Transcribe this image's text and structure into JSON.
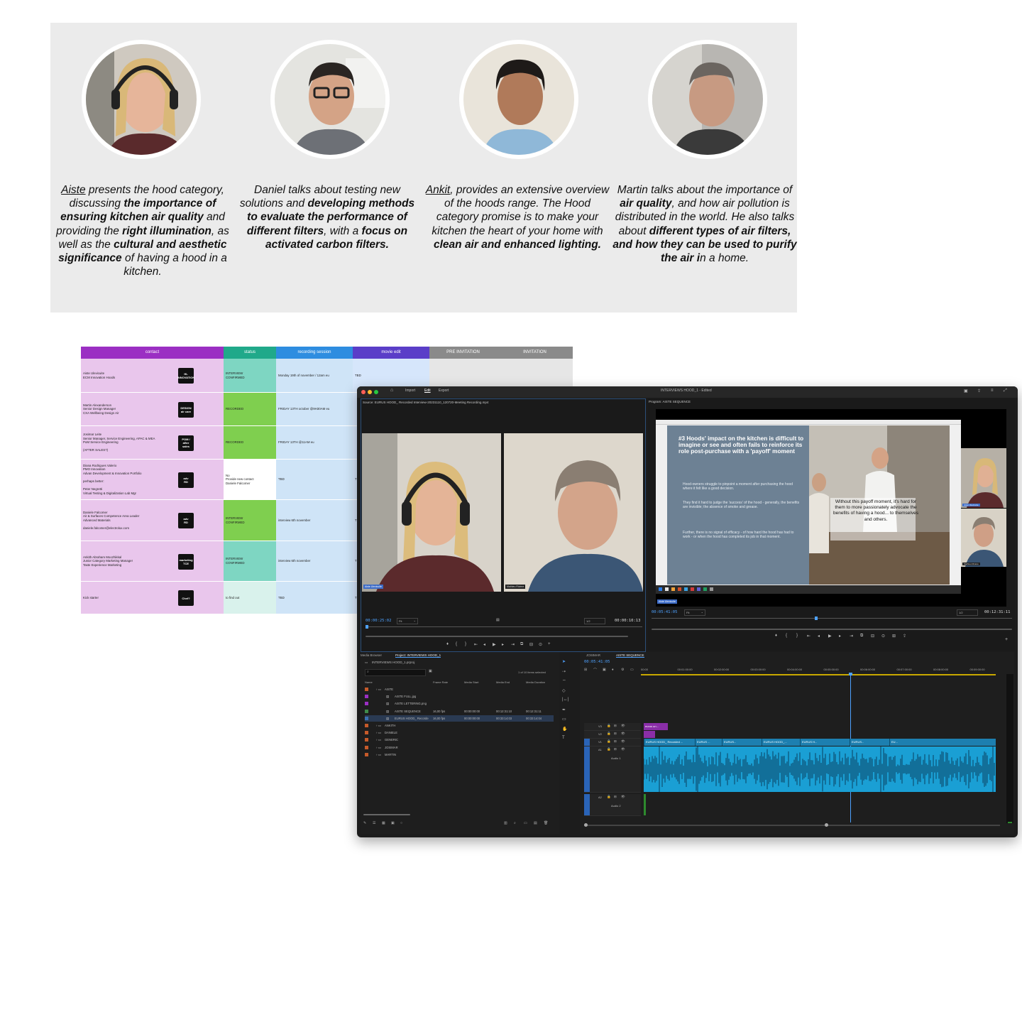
{
  "interviewees": [
    {
      "name": "Aiste",
      "bio_html": "<u>Aiste</u> presents the hood category, discussing <b>the importance of ensuring kitchen air quality</b> and providing the <b>right illumination</b>, as well as the <b>cultural and aesthetic significance</b> of having a hood in a kitchen."
    },
    {
      "name": "Daniel",
      "bio_html": "Daniel talks about testing new solutions and <b>developing methods to evaluate the performance of different filters</b>, with a <b>focus on activated carbon filters.</b>"
    },
    {
      "name": "Ankit",
      "bio_html": "<u>Ankit</u>, provides an extensive overview of the hoods range. The Hood category promise is to make your kitchen the heart of your home with <b>clean air and enhanced lighting.</b>"
    },
    {
      "name": "Martin",
      "bio_html": "Martin talks about the importance of <b>air quality</b>, and how air pollution is distributed in the world. He also talks about <b>different types of air filters, and how they can be used to purify the air i</b>n a home."
    }
  ],
  "sheet": {
    "headers": [
      {
        "label": "contact",
        "color": "#9b2fc3"
      },
      {
        "label": "status",
        "color": "#20a98a"
      },
      {
        "label": "recording session",
        "color": "#2e8de0"
      },
      {
        "label": "movie edit",
        "color": "#5a3ec8"
      },
      {
        "label": "PRE INVITATION",
        "color": "#8a8a8a"
      },
      {
        "label": "INVITATION",
        "color": "#8a8a8a"
      }
    ],
    "rows": [
      {
        "contact": "Aiste Ulevicuite\nECM Innovation Hoods",
        "sticker": "HL\nINNOVATION",
        "status": "INTERVIEW\nCONFIRMED",
        "status_color": "#7ed6c2",
        "session": "Monday 19th of november / 12am  eu",
        "edit": "TBD"
      },
      {
        "contact": "Martin Alexanderson\nSenior Design Manager\nCXA Wellbeing Design Air",
        "sticker": "DESIGN\nair care",
        "status": "RECORDED",
        "status_color": "#7fcf4f",
        "session": "FRIDAY 13TH october @9H30AM eu",
        "edit": ""
      },
      {
        "contact": "Josimar Leite\nSenior Manager, Service Engineering, APAC & MEA\nPoM Service Engineering\n\n(AFTER SALES?)",
        "sticker": "POM /\nafter\nsales",
        "status": "RECORDED",
        "status_color": "#7fcf4f",
        "session": "FRIDAY 13TH @11AM eu",
        "edit": ""
      },
      {
        "contact": "Diana Rodrigues Valerio\nPMO Innovation\nAdvan Development & Innovation Portfolio\n\nperhaps better:\n\nPeter Negretti\nVirtual Testing & Digitalization Lab Mgr",
        "sticker": "adv\nRD",
        "status": "No\nProvide new contact\nDaniele Falcomer",
        "status_color": "#ffffff",
        "session": "TBD",
        "edit": "T"
      },
      {
        "contact": "Daniele Falcomer\nAir & Surfaces Competence Area Leader\nAdvanced Materials\n\ndaniele.falcomer@electrolux.com",
        "sticker": "adv\nRD",
        "status": "INTERVIEW\nCONFIRMED",
        "status_color": "#7fcf4f",
        "session": "interview 6th november",
        "edit": "T"
      },
      {
        "contact": "Ankith Abraham Moozhikkal\nJunior Category Marketing Manager\nTaste Experience Marketing",
        "sticker": "marketing\nTCE",
        "status": "INTERVIEW\nCONFIRMED",
        "status_color": "#7ed6c2",
        "session": "interview 6th november",
        "edit": "T"
      },
      {
        "contact": "Kick starter",
        "sticker": "Chef?",
        "status": "to find out",
        "status_color": "#d9f2ec",
        "session": "TBD",
        "edit": "T"
      }
    ]
  },
  "editor": {
    "title": "INTERVIEWS HOOD_1 - Edited",
    "menu": [
      "Import",
      "Edit",
      "Export"
    ],
    "source_label": "Source: EURUS HOOD_ Recorded Interview-20231110_120720-Meeting Recording.mp4",
    "program_label": "Program: AISTE SEQUENCE",
    "source_timecode": "00:00:25:02",
    "source_fit": "Fit",
    "source_quality": "1/2",
    "source_duration": "00:00:10:13",
    "program_timecode": "00:05:41:05",
    "program_fit": "Fit",
    "program_quality": "1/2",
    "program_duration": "00:12:31:11",
    "name_tags": {
      "left": "Aiste Ulevicuite",
      "right": "Mathieu Riviere"
    },
    "slide": {
      "heading": "#3 Hoods' impact on the kitchen is difficult to imagine or see and often fails to reinforce its role post-purchase with a 'payoff' moment",
      "p1": "Hood-owners struggle to pinpoint a moment after purchasing the hood where it felt like a good decision.",
      "p2": "They find it hard to judge the 'success' of the hood - generally, the benefits are invisible; the absence of smoke and grease.",
      "p3": "Further, there is no signal of efficacy - of how hard the hood has had to work - or when the hood has completed its job in that moment.",
      "quote": "Without this payoff moment, it's hard for them to more passionately advocate the benefits of having a hood... to themselves and others.",
      "side_tag_top": "Aiste Ulevicuite",
      "side_tag_bottom": "Mathieu Riviere",
      "bottom_tag": "Aiste Ulevicuite"
    },
    "project": {
      "tabs": [
        "Media Browser",
        "Project: INTERVIEWS HOOD_1"
      ],
      "file": "INTERVIEWS HOOD_1.prproj",
      "selection": "1 of 10 items selected",
      "columns": [
        "Name",
        "Frame Rate",
        "Media Start",
        "Media End",
        "Media Duration"
      ],
      "items": [
        {
          "name": "AISTE",
          "indent": 0,
          "color": "#c65a2a",
          "rate": "",
          "start": "",
          "end": "",
          "dur": ""
        },
        {
          "name": "AISTE FULL.jpg",
          "indent": 1,
          "color": "#9b2fc3",
          "rate": "",
          "start": "",
          "end": "",
          "dur": ""
        },
        {
          "name": "AISTE LETTERING.png",
          "indent": 1,
          "color": "#9b2fc3",
          "rate": "",
          "start": "",
          "end": "",
          "dur": ""
        },
        {
          "name": "AISTE SEQUENCE",
          "indent": 1,
          "color": "#3f8a4a",
          "rate": "16,00 fps",
          "start": "00:00:00:00",
          "end": "00:12:31:10",
          "dur": "00:12:31:11"
        },
        {
          "name": "EURUS HOOD_ Recorde",
          "indent": 1,
          "color": "#3a6fb0",
          "rate": "16,00 fps",
          "start": "00:00:00:00",
          "end": "00:33:14:03",
          "dur": "00:33:14:04"
        },
        {
          "name": "ANKITH",
          "indent": 0,
          "color": "#c65a2a",
          "rate": "",
          "start": "",
          "end": "",
          "dur": ""
        },
        {
          "name": "DANIELE",
          "indent": 0,
          "color": "#c65a2a",
          "rate": "",
          "start": "",
          "end": "",
          "dur": ""
        },
        {
          "name": "GENERIC",
          "indent": 0,
          "color": "#c65a2a",
          "rate": "",
          "start": "",
          "end": "",
          "dur": ""
        },
        {
          "name": "JOSIMAR",
          "indent": 0,
          "color": "#c65a2a",
          "rate": "",
          "start": "",
          "end": "",
          "dur": ""
        },
        {
          "name": "MARTIN",
          "indent": 0,
          "color": "#c65a2a",
          "rate": "",
          "start": "",
          "end": "",
          "dur": ""
        }
      ]
    },
    "timeline": {
      "tabs": [
        "JOSIMAR",
        "AISTE SEQUENCE"
      ],
      "timecode": "00:05:41:05",
      "ruler": [
        "00:00",
        "00:01:00:00",
        "00:02:00:00",
        "00:03:00:00",
        "00:04:00:00",
        "00:05:00:00",
        "00:06:00:00",
        "00:07:00:00",
        "00:08:00:00",
        "00:09:00:00"
      ],
      "tracks": [
        "V3",
        "V2",
        "V1",
        "A1",
        "A2"
      ],
      "audio_names": [
        "Audio 1",
        "Audio 2"
      ],
      "v3_clip": "eurus un...",
      "v1_clips": [
        "EURUS HOOD_ Recorded ...",
        "EURUS ...",
        "EURUS...",
        "EURUS HOOD_...",
        "EURUS H...",
        "EURUS...",
        "EU..."
      ],
      "accent": "#1a9fd4"
    }
  }
}
